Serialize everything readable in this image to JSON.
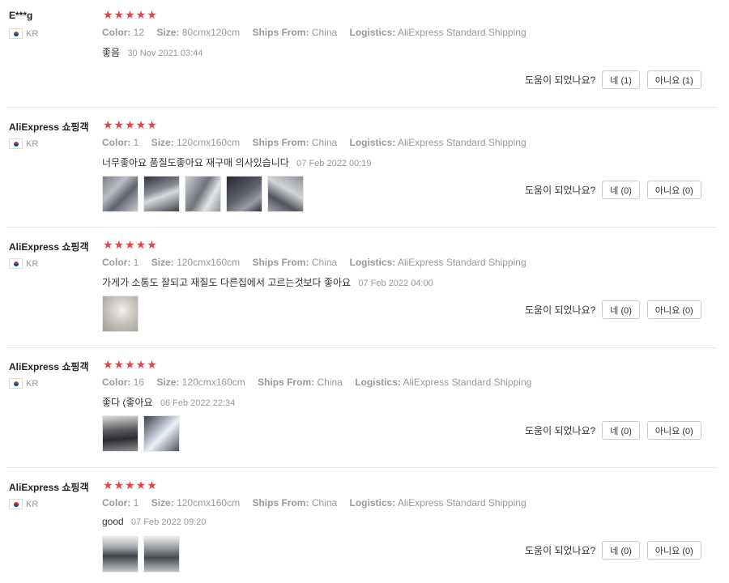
{
  "colors": {
    "star": "#e64545",
    "meta": "#999999",
    "divider": "#e6e6e6"
  },
  "icons": {
    "flag": "kr-flag-icon",
    "star": "star-icon"
  },
  "stars_char": "★★★★★",
  "labels": {
    "color": "Color:",
    "size": "Size:",
    "ships_from": "Ships From:",
    "logistics": "Logistics:",
    "helpful_question": "도움이 되었나요?"
  },
  "reviews": [
    {
      "user": "E***g",
      "country": "KR",
      "rating": 5,
      "color": "12",
      "size": "80cmx120cm",
      "ships_from": "China",
      "logistics": "AliExpress Standard Shipping",
      "comment": "좋음",
      "date": "30 Nov 2021 03:44",
      "yes_label": "네 (1)",
      "no_label": "아니요 (1)",
      "photo_count": 0
    },
    {
      "user": "AliExpress 쇼핑객",
      "country": "KR",
      "rating": 5,
      "color": "1",
      "size": "120cmx160cm",
      "ships_from": "China",
      "logistics": "AliExpress Standard Shipping",
      "comment": "너무좋아요 품질도좋아요 재구매 의사있습니다",
      "date": "07 Feb 2022 00:19",
      "yes_label": "네 (0)",
      "no_label": "아니요 (0)",
      "photo_count": 5
    },
    {
      "user": "AliExpress 쇼핑객",
      "country": "KR",
      "rating": 5,
      "color": "1",
      "size": "120cmx160cm",
      "ships_from": "China",
      "logistics": "AliExpress Standard Shipping",
      "comment": "가게가 소통도 잘되고 재질도 다른집에서 고르는것보다 좋아요",
      "date": "07 Feb 2022 04:00",
      "yes_label": "네 (0)",
      "no_label": "아니요 (0)",
      "photo_count": 1
    },
    {
      "user": "AliExpress 쇼핑객",
      "country": "KR",
      "rating": 5,
      "color": "16",
      "size": "120cmx160cm",
      "ships_from": "China",
      "logistics": "AliExpress Standard Shipping",
      "comment": "좋다 (좋아요",
      "date": "06 Feb 2022 22:34",
      "yes_label": "네 (0)",
      "no_label": "아니요 (0)",
      "photo_count": 2
    },
    {
      "user": "AliExpress 쇼핑객",
      "country": "KR",
      "rating": 5,
      "color": "1",
      "size": "120cmx160cm",
      "ships_from": "China",
      "logistics": "AliExpress Standard Shipping",
      "comment": "good",
      "date": "07 Feb 2022 09:20",
      "yes_label": "네 (0)",
      "no_label": "아니요 (0)",
      "photo_count": 2
    }
  ]
}
